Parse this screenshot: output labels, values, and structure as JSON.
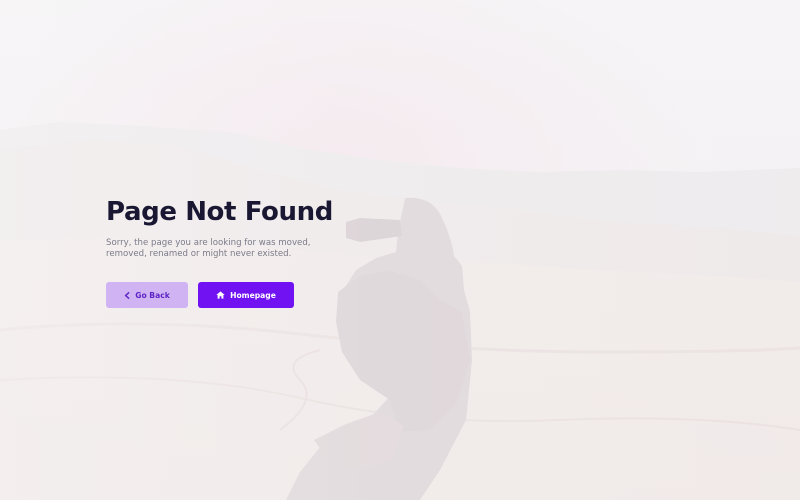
{
  "page": {
    "title": "Page Not Found",
    "message": "Sorry, the page you are looking for was moved, removed, renamed or might never existed."
  },
  "actions": {
    "back_label": "Go Back",
    "back_icon": "chevron-left-icon",
    "home_label": "Homepage",
    "home_icon": "home-icon"
  },
  "colors": {
    "title": "#1a1733",
    "text": "#7b7a88",
    "primary": "#7012f2",
    "primary_light": "#cfb3f3"
  }
}
